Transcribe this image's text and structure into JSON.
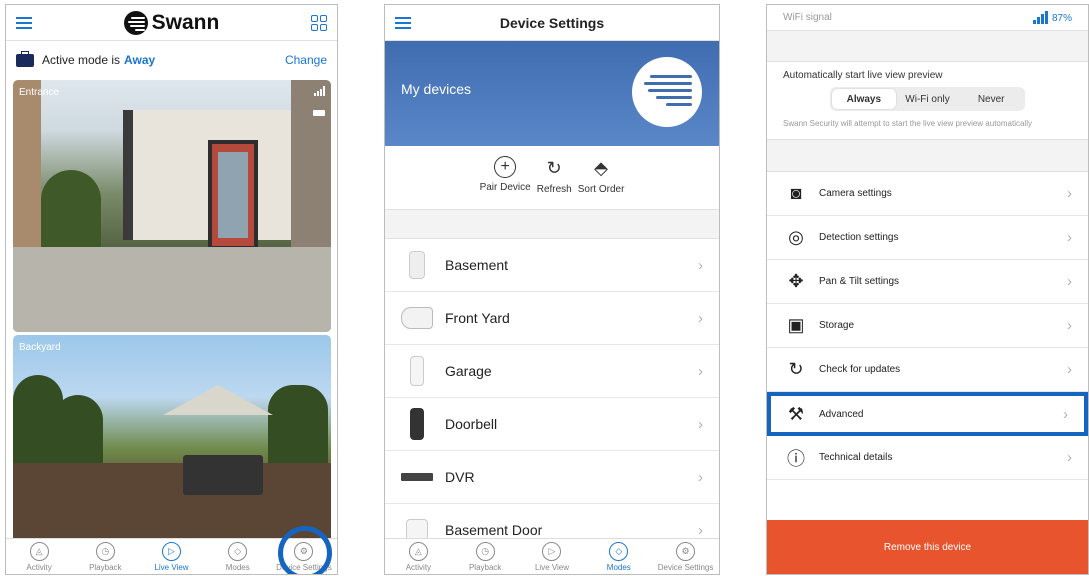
{
  "live_view": {
    "brand": "Swann",
    "mode_label": "Active mode is",
    "mode_value": "Away",
    "change": "Change",
    "cameras": [
      {
        "label": "Entrance"
      },
      {
        "label": "Backyard"
      }
    ],
    "tabs": [
      "Activity",
      "Playback",
      "Live View",
      "Modes",
      "Device Settings"
    ]
  },
  "device_settings": {
    "title": "Device Settings",
    "hero_title": "My devices",
    "actions": [
      {
        "label": "Pair Device",
        "icon": "plus-circle-icon"
      },
      {
        "label": "Refresh",
        "icon": "refresh-icon"
      },
      {
        "label": "Sort Order",
        "icon": "sort-icon"
      }
    ],
    "devices": [
      {
        "name": "Basement",
        "icon": "camera-icon"
      },
      {
        "name": "Front Yard",
        "icon": "camera-icon"
      },
      {
        "name": "Garage",
        "icon": "sensor-icon"
      },
      {
        "name": "Doorbell",
        "icon": "doorbell-icon"
      },
      {
        "name": "DVR",
        "icon": "dvr-icon"
      },
      {
        "name": "Basement Door",
        "icon": "sensor-icon"
      }
    ],
    "tabs": [
      "Activity",
      "Playback",
      "Live View",
      "Modes",
      "Device Settings"
    ]
  },
  "camera_settings": {
    "wifi_label": "WiFi signal",
    "wifi_value": "87%",
    "preview_label": "Automatically start live view preview",
    "preview_options": [
      "Always",
      "Wi-Fi only",
      "Never"
    ],
    "preview_selected": "Always",
    "preview_note": "Swann Security will attempt to start the live view preview automatically",
    "items": [
      {
        "label": "Camera settings",
        "icon": "camera-icon"
      },
      {
        "label": "Detection settings",
        "icon": "radar-icon"
      },
      {
        "label": "Pan & Tilt settings",
        "icon": "move-icon"
      },
      {
        "label": "Storage",
        "icon": "save-icon"
      },
      {
        "label": "Check for updates",
        "icon": "update-icon"
      },
      {
        "label": "Advanced",
        "icon": "wrench-icon"
      },
      {
        "label": "Technical details",
        "icon": "info-icon"
      }
    ],
    "remove": "Remove this device"
  },
  "colors": {
    "accent": "#1976d2",
    "highlight": "#1565c0",
    "danger": "#e8542e"
  }
}
